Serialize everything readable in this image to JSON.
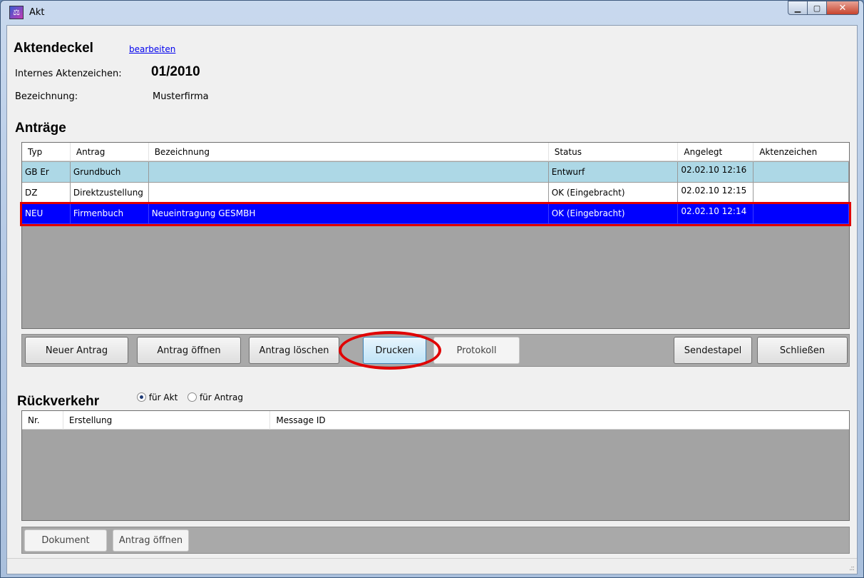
{
  "window": {
    "title": "Akt",
    "icon": "app-logo-icon"
  },
  "header": {
    "heading": "Aktendeckel",
    "edit_link": "bearbeiten",
    "internal_ref_label": "Internes Aktenzeichen:",
    "internal_ref_value": "01/2010",
    "designation_label": "Bezeichnung:",
    "designation_value": "Musterfirma"
  },
  "antraege": {
    "heading": "Anträge",
    "columns": [
      "Typ",
      "Antrag",
      "Bezeichnung",
      "Status",
      "Angelegt",
      "Aktenzeichen"
    ],
    "rows": [
      {
        "typ": "GB Er",
        "antrag": "Grundbuch",
        "bezeichnung": "",
        "status": "Entwurf",
        "angelegt": "02.02.10 12:16",
        "aktenzeichen": ""
      },
      {
        "typ": "DZ",
        "antrag": "Direktzustellung",
        "bezeichnung": "",
        "status": "OK (Eingebracht)",
        "angelegt": "02.02.10 12:15",
        "aktenzeichen": ""
      },
      {
        "typ": "NEU",
        "antrag": "Firmenbuch",
        "bezeichnung": "Neueintragung GESMBH",
        "status": "OK (Eingebracht)",
        "angelegt": "02.02.10 12:14",
        "aktenzeichen": ""
      }
    ],
    "buttons": {
      "new": "Neuer Antrag",
      "open": "Antrag öffnen",
      "delete": "Antrag löschen",
      "print": "Drucken",
      "protocol": "Protokoll",
      "send_stack": "Sendestapel",
      "close": "Schließen"
    }
  },
  "rueckverkehr": {
    "heading": "Rückverkehr",
    "radio_akt": "für Akt",
    "radio_antrag": "für Antrag",
    "selected": "für Akt",
    "columns": [
      "Nr.",
      "Erstellung",
      "Message ID"
    ],
    "buttons": {
      "document": "Dokument",
      "open": "Antrag öffnen"
    }
  },
  "colors": {
    "row_highlight": "#add8e6",
    "row_selected": "#0000ff",
    "annotation": "#e00000"
  }
}
